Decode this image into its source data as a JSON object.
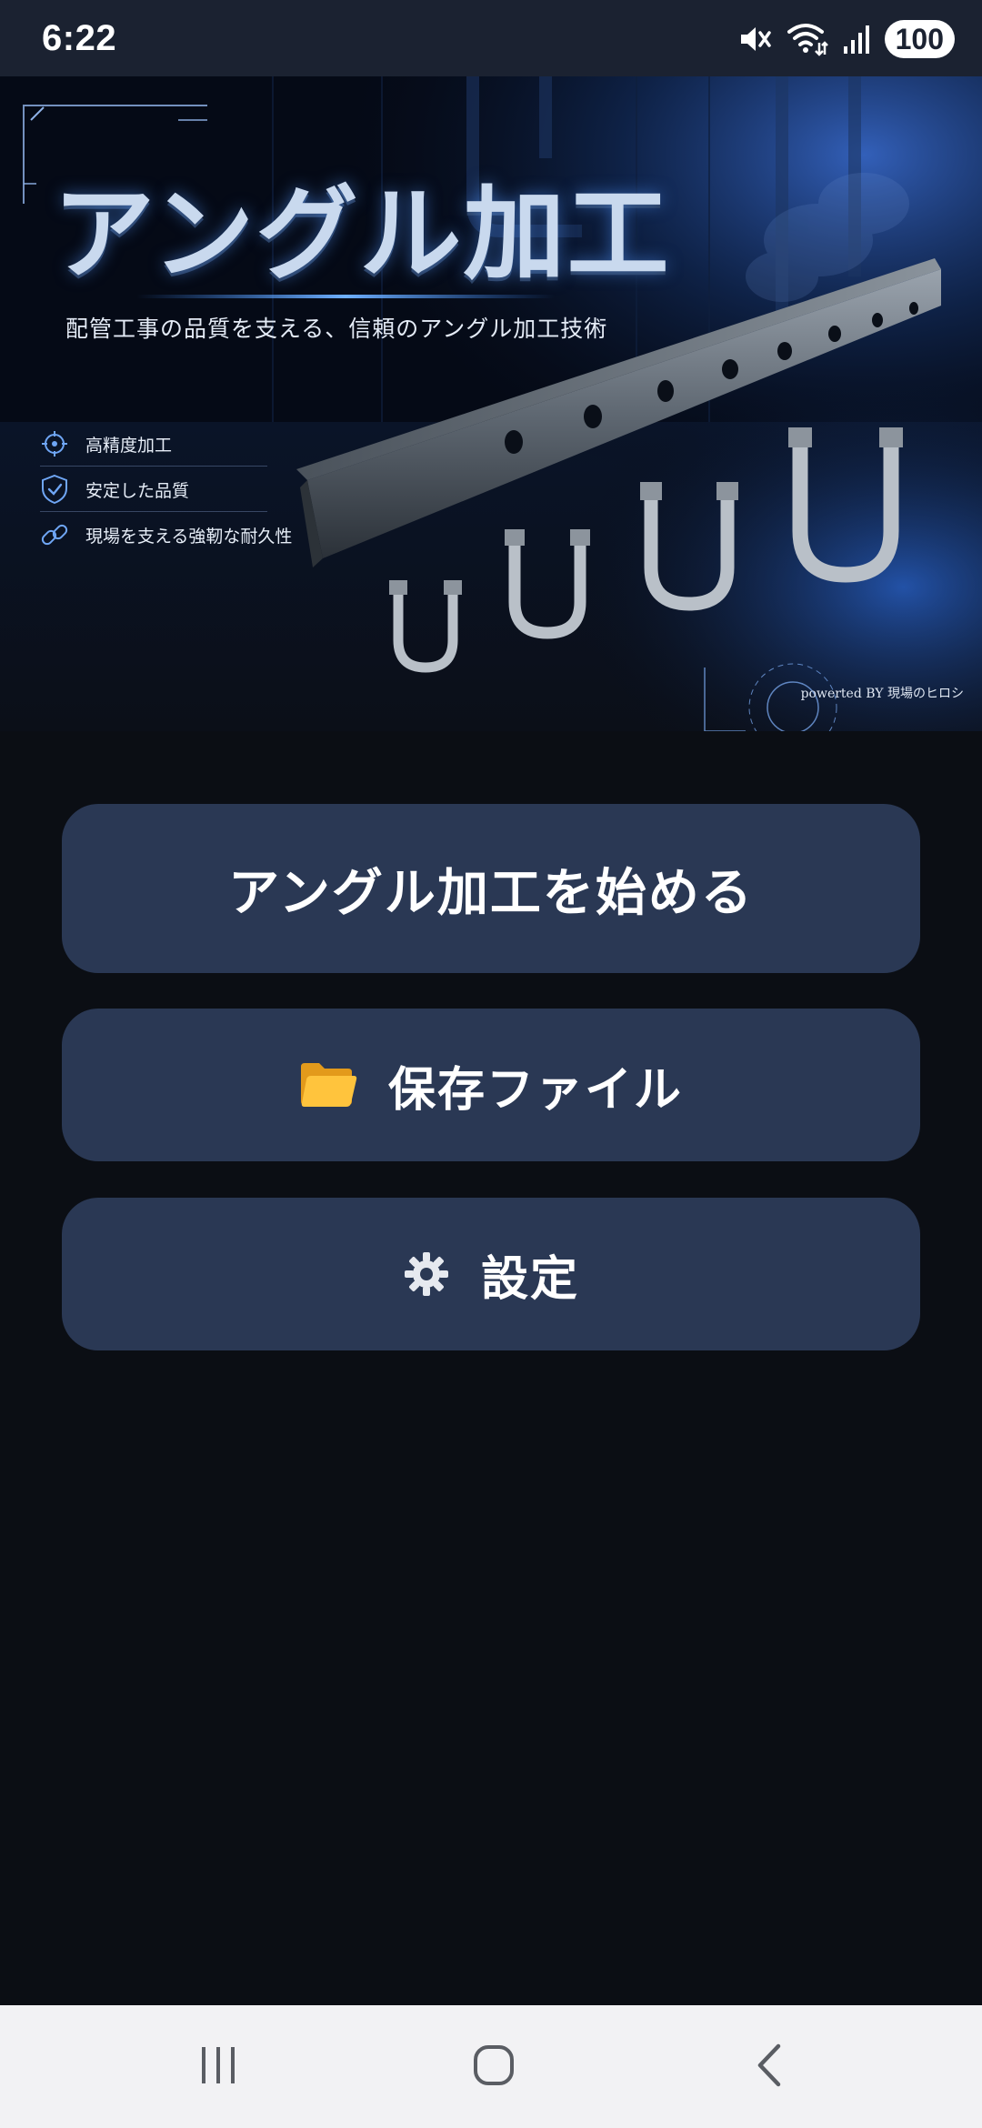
{
  "status_bar": {
    "time": "6:22",
    "battery": "100",
    "icons": [
      "mute-icon",
      "wifi-icon",
      "signal-icon",
      "battery-icon"
    ]
  },
  "hero": {
    "title": "アングル加工",
    "subtitle": "配管工事の品質を支える、信頼のアングル加工技術",
    "features": [
      {
        "icon": "crosshair-icon",
        "label": "高精度加工"
      },
      {
        "icon": "shield-check-icon",
        "label": "安定した品質"
      },
      {
        "icon": "link-icon",
        "label": "現場を支える強靭な耐久性"
      }
    ],
    "credit": "powerted BY 現場のヒロシ"
  },
  "menu": {
    "start_label": "アングル加工を始める",
    "files_label": "保存ファイル",
    "files_icon": "folder-icon",
    "settings_label": "設定",
    "settings_icon": "gear-icon"
  },
  "nav_bar": {
    "buttons": [
      "recent-apps-icon",
      "home-icon",
      "back-icon"
    ]
  },
  "colors": {
    "background": "#0b0e14",
    "status_bar": "#1b2231",
    "button": "#2a3854",
    "nav_bar": "#f2f2f4",
    "accent": "#3a7bff"
  }
}
